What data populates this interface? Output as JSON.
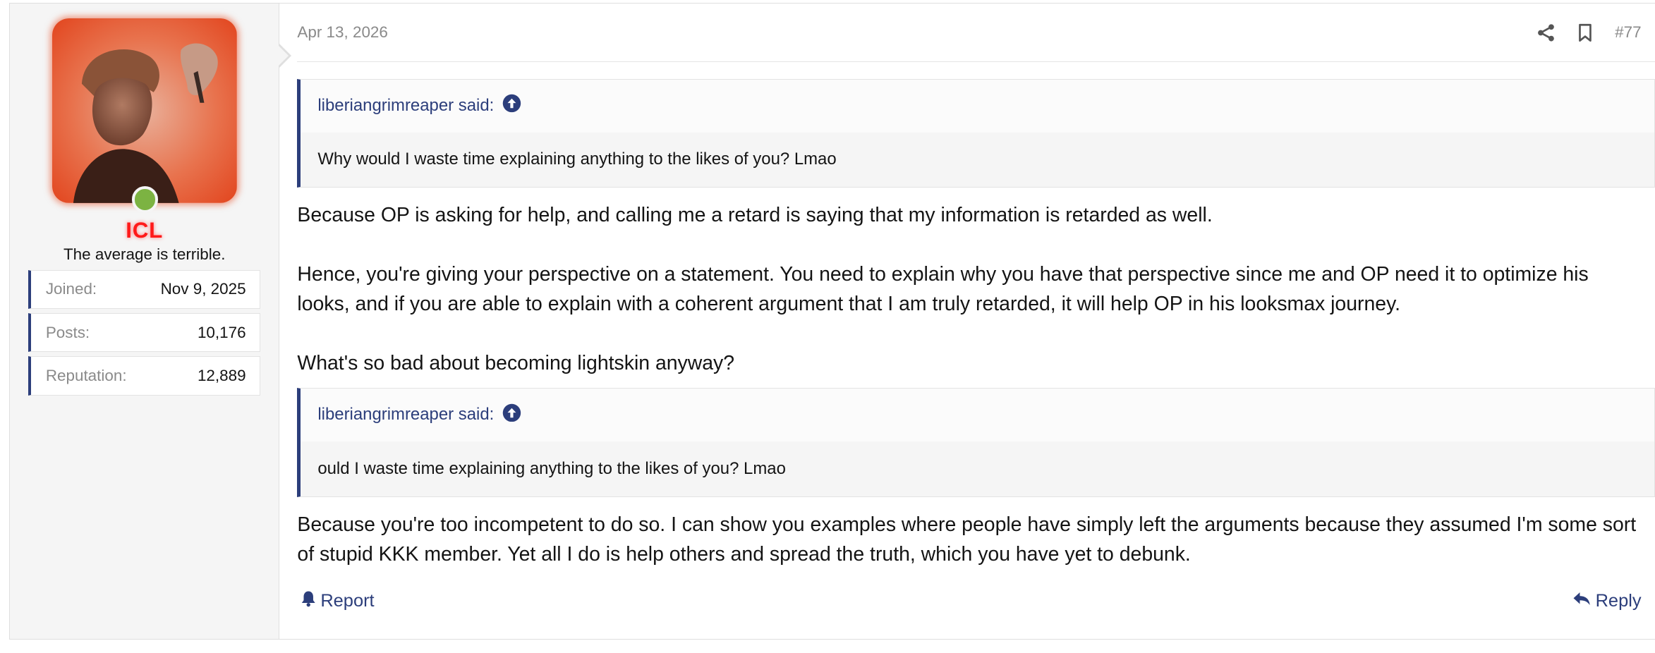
{
  "user": {
    "username": "ICL",
    "title": "The average is terrible.",
    "stats": [
      {
        "label": "Joined:",
        "value": "Nov 9, 2025"
      },
      {
        "label": "Posts:",
        "value": "10,176"
      },
      {
        "label": "Reputation:",
        "value": "12,889"
      }
    ]
  },
  "post": {
    "date": "Apr 13, 2026",
    "number": "#77",
    "icons": [
      "share-icon",
      "bookmark-icon"
    ],
    "quotes": [
      {
        "author": "liberiangrimreaper said:",
        "text": "Why would I waste time explaining anything to the likes of you? Lmao"
      },
      {
        "author": "liberiangrimreaper said:",
        "text": "ould I waste time explaining anything to the likes of you? Lmao"
      }
    ],
    "paragraphs": [
      "Because OP is asking for help, and calling me a retard is saying that my information is retarded as well.",
      "Hence, you're giving your perspective on a statement. You need to explain why you have that perspective since me and OP need it to optimize his looks, and if you are able to explain with a coherent argument that I am truly retarded, it will help OP in his looksmax journey.",
      "What's so bad about becoming lightskin anyway?",
      "Because you're too incompetent to do so. I can show you examples where people have simply left the arguments because they assumed I'm some sort of stupid KKK member. Yet all I do is help others and spread the truth, which you have yet to debunk."
    ],
    "actions": {
      "report": "Report",
      "reply": "Reply"
    }
  },
  "colors": {
    "accent": "#2c3e7b",
    "username": "#ff1a1a",
    "online": "#7cb342",
    "muted": "#8a8a8a"
  }
}
